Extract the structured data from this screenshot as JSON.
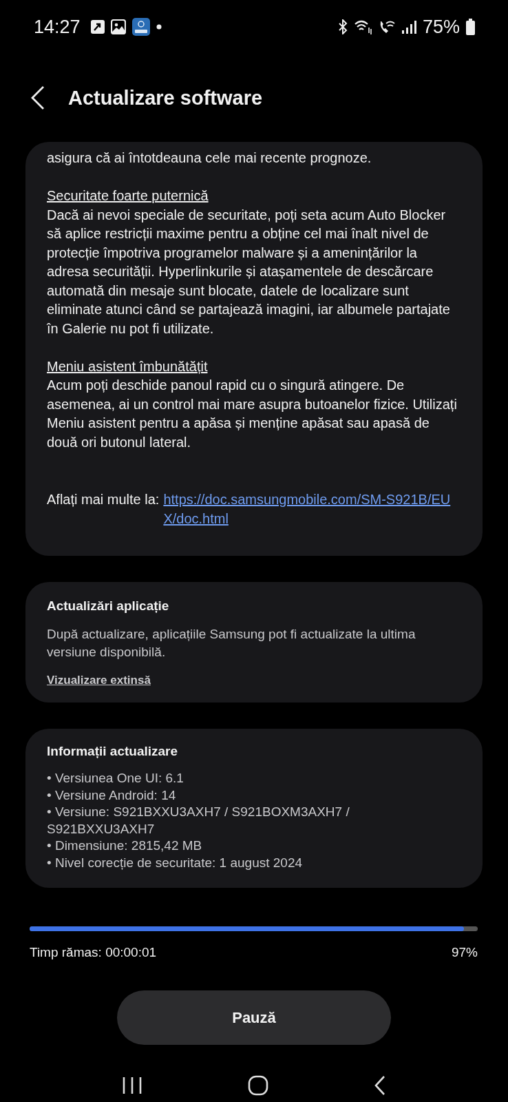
{
  "status_bar": {
    "time": "14:27",
    "battery": "75%"
  },
  "header": {
    "title": "Actualizare software"
  },
  "release_notes": {
    "intro_tail": "asigura că ai întotdeauna cele mai recente prognoze.",
    "sections": [
      {
        "title": "Securitate foarte puternică",
        "body": "Dacă ai nevoi speciale de securitate, poți seta acum Auto Blocker să aplice restricții maxime pentru a obține cel mai înalt nivel de protecție împotriva programelor malware și a amenințărilor la adresa securității. Hyperlinkurile și atașamentele de descărcare automată din mesaje sunt blocate, datele de localizare sunt eliminate atunci când se partajează imagini, iar albumele partajate în Galerie nu pot fi utilizate."
      },
      {
        "title": "Meniu asistent îmbunătățit",
        "body": "Acum poți deschide panoul rapid cu o singură atingere. De asemenea, ai un control mai mare asupra butoanelor fizice. Utilizați Meniu asistent pentru a apăsa și menține apăsat sau apasă de două ori butonul lateral."
      }
    ],
    "more_info": {
      "label": "Aflați mai multe la:",
      "link": "https://doc.samsungmobile.com/SM-S921B/EUX/doc.html"
    }
  },
  "app_updates": {
    "title": "Actualizări aplicație",
    "body": "După actualizare, aplicațiile Samsung pot fi actualizate la ultima versiune disponibilă.",
    "link": "Vizualizare extinsă"
  },
  "update_info": {
    "title": "Informații actualizare",
    "items": [
      "• Versiunea One UI: 6.1",
      "• Versiune Android: 14",
      "• Versiune: S921BXXU3AXH7 / S921BOXM3AXH7 / S921BXXU3AXH7",
      "• Dimensiune: 2815,42 MB",
      "• Nivel corecție de securitate: 1 august 2024"
    ]
  },
  "progress": {
    "level": 0.97,
    "time_left": "Timp rămas: 00:00:01",
    "percent": "97%"
  },
  "pause_button": "Pauză"
}
